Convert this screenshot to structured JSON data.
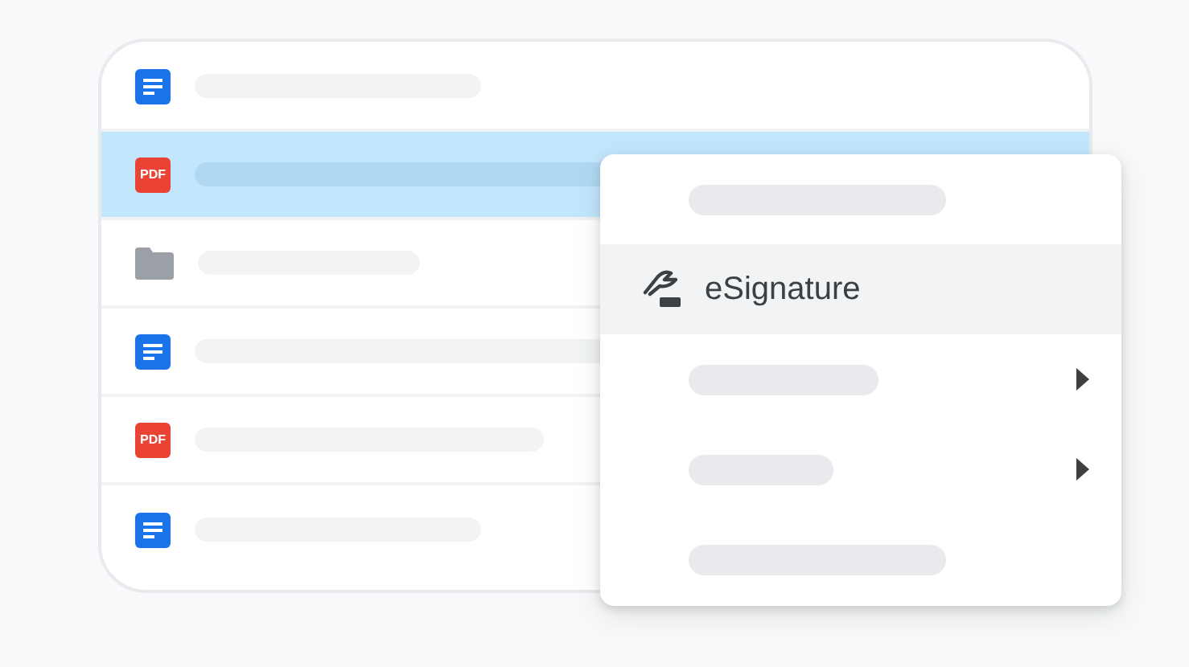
{
  "files": [
    {
      "kind": "doc",
      "selected": false
    },
    {
      "kind": "pdf",
      "label": "PDF",
      "selected": true
    },
    {
      "kind": "folder",
      "selected": false
    },
    {
      "kind": "doc",
      "selected": false
    },
    {
      "kind": "pdf",
      "label": "PDF",
      "selected": false
    },
    {
      "kind": "doc",
      "selected": false
    }
  ],
  "context_menu": {
    "items": [
      {
        "kind": "placeholder",
        "selected": false,
        "submenu": false
      },
      {
        "kind": "action",
        "label": "eSignature",
        "selected": true,
        "submenu": false
      },
      {
        "kind": "placeholder",
        "selected": false,
        "submenu": true
      },
      {
        "kind": "placeholder",
        "selected": false,
        "submenu": true
      },
      {
        "kind": "placeholder",
        "selected": false,
        "submenu": false
      }
    ]
  }
}
